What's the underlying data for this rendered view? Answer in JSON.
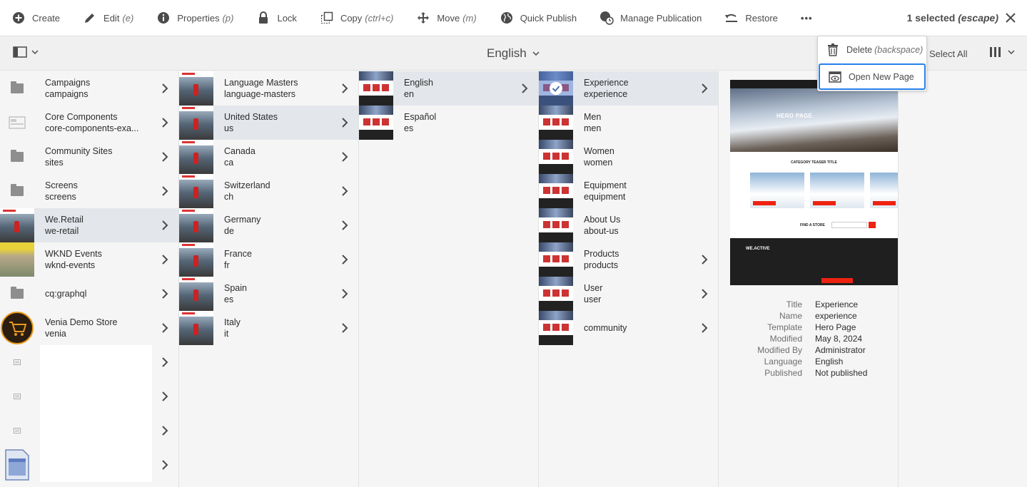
{
  "actionbar": {
    "create": "Create",
    "edit": "Edit",
    "edit_kbd": "(e)",
    "properties": "Properties",
    "properties_kbd": "(p)",
    "lock": "Lock",
    "copy": "Copy",
    "copy_kbd": "(ctrl+c)",
    "move": "Move",
    "move_kbd": "(m)",
    "quick_publish": "Quick Publish",
    "manage_publication": "Manage Publication",
    "restore": "Restore",
    "more": "•••",
    "selected_count": "1 selected",
    "selected_kbd": "(escape)"
  },
  "titlebar": {
    "title": "English",
    "select_all": "Select All"
  },
  "popover": {
    "delete": "Delete",
    "delete_kbd": "(backspace)",
    "open_new_page": "Open New Page"
  },
  "col1": [
    {
      "title": "Campaigns",
      "name": "campaigns",
      "thumb": "folder-icon"
    },
    {
      "title": "Core Components",
      "name": "core-components-exa...",
      "thumb": "template-icon"
    },
    {
      "title": "Community Sites",
      "name": "sites",
      "thumb": "folder-icon"
    },
    {
      "title": "Screens",
      "name": "screens",
      "thumb": "folder-icon"
    },
    {
      "title": "We.Retail",
      "name": "we-retail",
      "thumb": "page-thumb",
      "selected": true
    },
    {
      "title": "WKND Events",
      "name": "wknd-events",
      "thumb": "photo-thumb"
    },
    {
      "title": "cq:graphql",
      "name": "",
      "thumb": "folder-icon"
    },
    {
      "title": "Venia Demo Store",
      "name": "venia",
      "thumb": "cart-logo"
    },
    {
      "title": "",
      "name": "",
      "thumb": "doc-icon"
    },
    {
      "title": "",
      "name": "",
      "thumb": "doc-icon"
    },
    {
      "title": "",
      "name": "",
      "thumb": "doc-icon"
    },
    {
      "title": "",
      "name": "",
      "thumb": "page-icon"
    }
  ],
  "col2": [
    {
      "title": "Language Masters",
      "name": "language-masters"
    },
    {
      "title": "United States",
      "name": "us",
      "selected": true
    },
    {
      "title": "Canada",
      "name": "ca"
    },
    {
      "title": "Switzerland",
      "name": "ch"
    },
    {
      "title": "Germany",
      "name": "de"
    },
    {
      "title": "France",
      "name": "fr"
    },
    {
      "title": "Spain",
      "name": "es"
    },
    {
      "title": "Italy",
      "name": "it"
    }
  ],
  "col3": [
    {
      "title": "English",
      "name": "en",
      "selected": true,
      "chevron": true
    },
    {
      "title": "Español",
      "name": "es",
      "chevron": false
    }
  ],
  "col4": [
    {
      "title": "Experience",
      "name": "experience",
      "selected": true,
      "chevron": true
    },
    {
      "title": "Men",
      "name": "men",
      "chevron": false
    },
    {
      "title": "Women",
      "name": "women",
      "chevron": false
    },
    {
      "title": "Equipment",
      "name": "equipment",
      "chevron": false
    },
    {
      "title": "About Us",
      "name": "about-us",
      "chevron": false
    },
    {
      "title": "Products",
      "name": "products",
      "chevron": true
    },
    {
      "title": "User",
      "name": "user",
      "chevron": true
    },
    {
      "title": "community",
      "name": "",
      "chevron": true
    }
  ],
  "preview": {
    "hero_text": "HERO PAGE",
    "category_text": "CATEGORY TEASER TITLE",
    "find_text": "FIND A STORE",
    "footer_brand": "WE.ACTIVE",
    "meta": [
      {
        "k": "Title",
        "v": "Experience"
      },
      {
        "k": "Name",
        "v": "experience"
      },
      {
        "k": "Template",
        "v": "Hero Page"
      },
      {
        "k": "Modified",
        "v": "May 8, 2024"
      },
      {
        "k": "Modified By",
        "v": "Administrator"
      },
      {
        "k": "Language",
        "v": "English"
      },
      {
        "k": "Published",
        "v": "Not published"
      }
    ]
  },
  "colors": {
    "selected_row": "#e3e6eb",
    "accent_focus": "#2680eb",
    "brand_red": "#e21"
  }
}
